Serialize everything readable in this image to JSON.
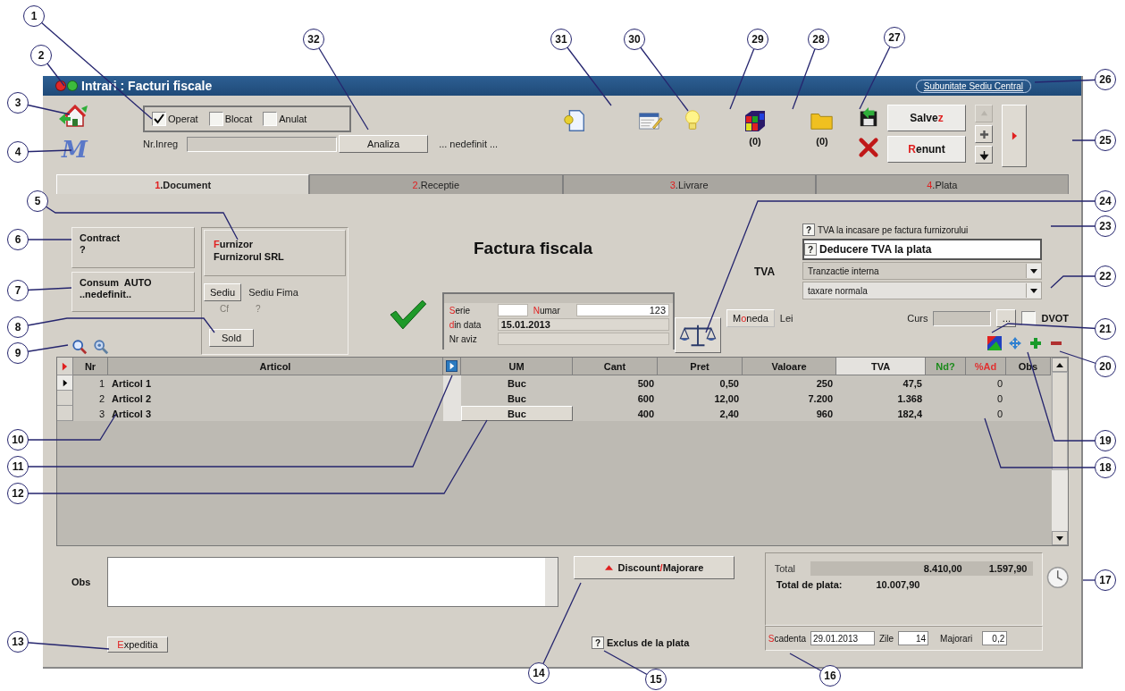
{
  "callouts": [
    {
      "number": "1"
    },
    {
      "number": "2"
    },
    {
      "number": "3"
    },
    {
      "number": "4"
    },
    {
      "number": "5"
    },
    {
      "number": "6"
    },
    {
      "number": "7"
    },
    {
      "number": "8"
    },
    {
      "number": "9"
    },
    {
      "number": "10"
    },
    {
      "number": "11"
    },
    {
      "number": "12"
    },
    {
      "number": "13"
    },
    {
      "number": "14"
    },
    {
      "number": "15"
    },
    {
      "number": "16"
    },
    {
      "number": "26"
    },
    {
      "number": "25"
    },
    {
      "number": "24"
    },
    {
      "number": "23"
    },
    {
      "number": "22"
    },
    {
      "number": "21"
    },
    {
      "number": "20"
    },
    {
      "number": "19"
    },
    {
      "number": "18"
    },
    {
      "number": "17"
    },
    {
      "number": "32"
    },
    {
      "number": "31"
    },
    {
      "number": "30"
    },
    {
      "number": "29"
    },
    {
      "number": "28"
    },
    {
      "number": "27"
    }
  ],
  "window": {
    "title": "Intrari : Facturi fiscale",
    "subunit": "Subunitate Sediu Central"
  },
  "logo_text": "M",
  "status_checks": [
    {
      "label": "Operat",
      "checked": true
    },
    {
      "label": "Blocat",
      "checked": false
    },
    {
      "label": "Anulat",
      "checked": false
    }
  ],
  "registration": {
    "label": "Nr.Inreg"
  },
  "analyze_button": "Analiza",
  "analysis_value": "... nedefinit ...",
  "toolbar": [
    {
      "kind": "document"
    },
    {
      "kind": "form"
    },
    {
      "kind": "bulb"
    },
    {
      "kind": "cube",
      "count": "(0)"
    },
    {
      "kind": "folder",
      "count": "(0)"
    }
  ],
  "save_button": [
    {
      "text": "Salve",
      "accent": false
    },
    {
      "text": "z",
      "accent": true
    }
  ],
  "cancel_button": [
    {
      "text": "R",
      "accent": true
    },
    {
      "text": "enunt",
      "accent": false
    }
  ],
  "nav_buttons": [
    {
      "kind": "up",
      "disabled": true
    },
    {
      "kind": "plus",
      "disabled": false
    },
    {
      "kind": "down",
      "disabled": false
    }
  ],
  "tabs": [
    {
      "hotkey": "1",
      "label": ".Document",
      "selected": true
    },
    {
      "hotkey": "2",
      "label": ".Receptie",
      "selected": false
    },
    {
      "hotkey": "3",
      "label": ".Livrare",
      "selected": false
    },
    {
      "hotkey": "4",
      "label": ".Plata",
      "selected": false
    }
  ],
  "contract": {
    "label": "Contract",
    "value": "?"
  },
  "consumption": {
    "label": "Consum  AUTO",
    "value": "..nedefinit.."
  },
  "supplier": {
    "label": [
      {
        "text": "F",
        "accent": true
      },
      {
        "text": "urnizor",
        "accent": false
      }
    ],
    "value": "Furnizorul SRL"
  },
  "seat_button": "Sediu",
  "seat_value": "Sediu Fima",
  "cf_row": {
    "label": "Cf",
    "value": "?",
    "disabled": true
  },
  "balance_button": "Sold",
  "doc_title": "Factura fiscala",
  "doc": {
    "series_label": [
      {
        "text": "S",
        "accent": true
      },
      {
        "text": "erie",
        "accent": false
      }
    ],
    "number_label": [
      {
        "text": "N",
        "accent": true
      },
      {
        "text": "umar",
        "accent": false
      }
    ],
    "number": "123",
    "date_label": [
      {
        "text": "d",
        "accent": true
      },
      {
        "text": "in data",
        "accent": false
      }
    ],
    "date": "15.01.2013",
    "notice_label": "Nr aviz"
  },
  "tva": {
    "label": "TVA",
    "options": [
      {
        "mark": "?",
        "indeterminate": true,
        "label": "TVA la incasare pe factura furnizorului",
        "kind": "plain"
      },
      {
        "mark": "?",
        "indeterminate": true,
        "label": "Deducere TVA la plata",
        "kind": "boxed"
      }
    ],
    "dropdowns": [
      "Tranzactie interna",
      "taxare normala"
    ]
  },
  "currency": {
    "button": [
      {
        "text": "M",
        "accent": false
      },
      {
        "text": "o",
        "accent": true
      },
      {
        "text": "neda",
        "accent": false
      }
    ],
    "value": "Lei",
    "rate_label": "Curs",
    "rate_button": "...",
    "dvot": {
      "label": "DVOT",
      "checked": false
    }
  },
  "table": {
    "columns": [
      {
        "label": "Nr",
        "highlighted": false
      },
      {
        "label": "Articol",
        "highlighted": false
      },
      {
        "label": "UM",
        "highlighted": false
      },
      {
        "label": "Cant",
        "highlighted": false
      },
      {
        "label": "Pret",
        "highlighted": false
      },
      {
        "label": "Valoare",
        "highlighted": false
      },
      {
        "label": "TVA",
        "highlighted": true
      },
      {
        "label": "Nd?",
        "highlighted": false,
        "color": "#1a8a1a"
      },
      {
        "label": "%Ad",
        "highlighted": false,
        "color": "#e03030"
      },
      {
        "label": "Obs",
        "highlighted": false
      }
    ],
    "rows": [
      {
        "nr": "1",
        "article": "Articol 1",
        "um": "Buc",
        "qty": "500",
        "price": "0,50",
        "value": "250",
        "tva": "47,5",
        "ad": "0",
        "selected": true,
        "editing": false
      },
      {
        "nr": "2",
        "article": "Articol 2",
        "um": "Buc",
        "qty": "600",
        "price": "12,00",
        "value": "7.200",
        "tva": "1.368",
        "ad": "0",
        "selected": false,
        "editing": false
      },
      {
        "nr": "3",
        "article": "Articol 3",
        "um": "Buc",
        "qty": "400",
        "price": "2,40",
        "value": "960",
        "tva": "182,4",
        "ad": "0",
        "selected": false,
        "editing": true
      }
    ]
  },
  "notes": {
    "label": "Obs"
  },
  "shipping_button": [
    {
      "text": "E",
      "accent": true
    },
    {
      "text": "xpeditia",
      "accent": false
    }
  ],
  "discount_button": [
    {
      "text": "Discount",
      "accent": false
    },
    {
      "text": "/",
      "accent": true
    },
    {
      "text": "Majorare",
      "accent": false
    }
  ],
  "exclude": {
    "mark": "?",
    "indeterminate": true,
    "label": "Exclus de la plata"
  },
  "totals": {
    "label": "Total",
    "net": "8.410,00",
    "vat": "1.597,90",
    "grand_label": "Total de plata:",
    "grand": "10.007,90",
    "due_label": [
      {
        "text": "S",
        "accent": true
      },
      {
        "text": "cadenta",
        "accent": false
      }
    ],
    "due_date": "29.01.2013",
    "days_label": "Zile",
    "days": "14",
    "penalty_label": "Majorari",
    "penalty": "0,2"
  }
}
